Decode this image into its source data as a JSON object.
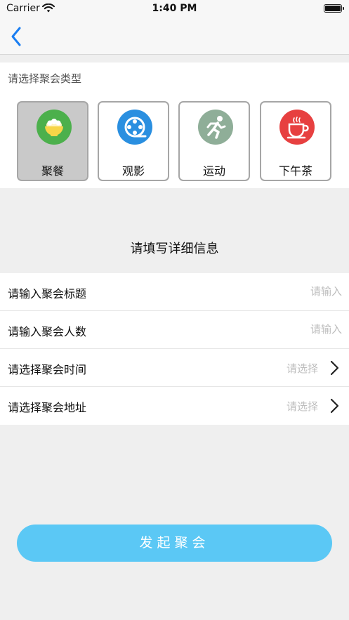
{
  "status_bar": {
    "carrier": "Carrier",
    "time": "1:40 PM"
  },
  "nav": {
    "back_icon": "chevron-left-icon"
  },
  "type_section": {
    "heading": "请选择聚会类型",
    "types": [
      {
        "label": "聚餐",
        "icon": "rice-bowl-icon",
        "color": "#4cb04c",
        "selected": true
      },
      {
        "label": "观影",
        "icon": "film-reel-icon",
        "color": "#2a8fe0",
        "selected": false
      },
      {
        "label": "运动",
        "icon": "runner-icon",
        "color": "#8fae98",
        "selected": false
      },
      {
        "label": "下午茶",
        "icon": "tea-cup-icon",
        "color": "#e74040",
        "selected": false
      }
    ]
  },
  "details": {
    "heading": "请填写详细信息",
    "rows": [
      {
        "label": "请输入聚会标题",
        "placeholder": "请输入"
      },
      {
        "label": "请输入聚会人数",
        "placeholder": "请输入"
      },
      {
        "label": "请选择聚会时间",
        "value": "请选择"
      },
      {
        "label": "请选择聚会地址",
        "value": "请选择"
      }
    ]
  },
  "submit": {
    "label": "发起聚会",
    "color": "#5bc8f5"
  }
}
